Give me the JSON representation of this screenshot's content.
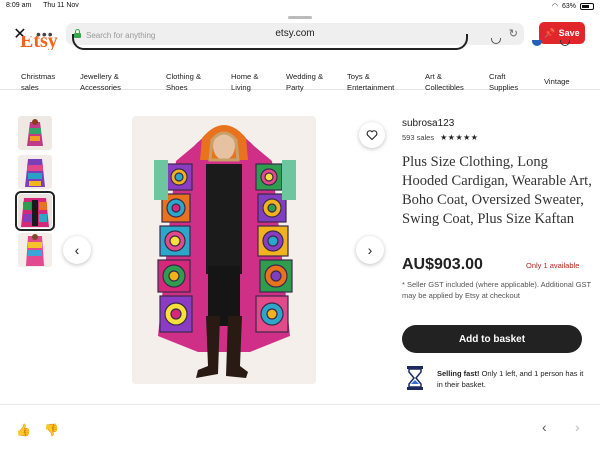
{
  "status_bar": {
    "time": "8:09 am",
    "date": "Thu 11 Nov",
    "battery": "63%"
  },
  "browser": {
    "url": "etsy.com",
    "save_label": "Save",
    "icons": [
      "close-icon",
      "more-icon",
      "lock-icon",
      "reload-icon",
      "pin-icon"
    ]
  },
  "header": {
    "logo": "Etsy",
    "search_placeholder": "Search for anything"
  },
  "categories": [
    {
      "line1": "Christmas",
      "line2": "sales"
    },
    {
      "line1": "Jewellery &",
      "line2": "Accessories"
    },
    {
      "line1": "Clothing &",
      "line2": "Shoes"
    },
    {
      "line1": "Home &",
      "line2": "Living"
    },
    {
      "line1": "Wedding &",
      "line2": "Party"
    },
    {
      "line1": "Toys &",
      "line2": "Entertainment"
    },
    {
      "line1": "Art &",
      "line2": "Collectibles"
    },
    {
      "line1": "Craft",
      "line2": "Supplies"
    },
    {
      "line1": "Vintage",
      "line2": ""
    }
  ],
  "gallery": {
    "thumb_count": 4,
    "selected_thumb": 3
  },
  "product": {
    "shop_name": "subrosa123",
    "sales": "593 sales",
    "rating_stars": "★★★★★",
    "title": "Plus Size Clothing, Long Hooded Cardigan, Wearable Art, Boho Coat, Oversized Sweater, Swing Coat, Plus Size Kaftan",
    "price": "AU$903.00",
    "stock": "Only 1 available",
    "gst_note": "* Seller GST included (where applicable). Additional GST may be applied by Etsy at checkout",
    "add_to_basket": "Add to basket",
    "selling_fast_bold": "Selling fast!",
    "selling_fast_rest": " Only 1 left, and 1 person has it in their basket."
  },
  "colors": {
    "etsy_orange": "#f1641e",
    "save_red": "#e0262b",
    "stock_red": "#b3261e",
    "button_black": "#222222"
  }
}
